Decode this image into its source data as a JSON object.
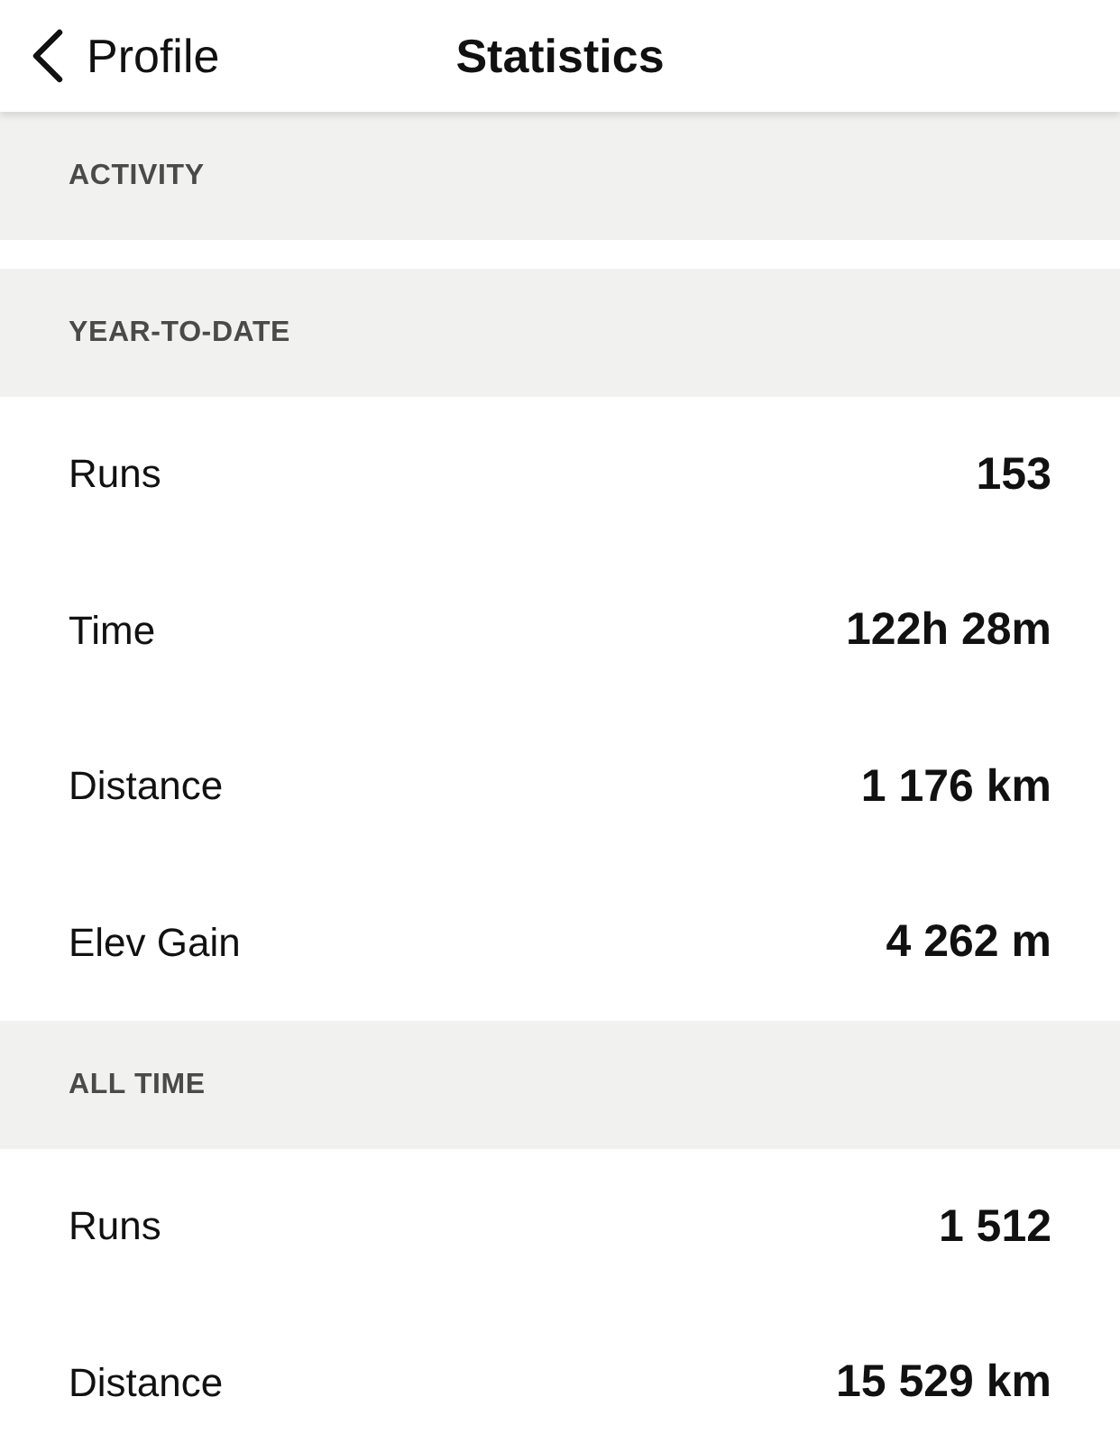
{
  "header": {
    "back_label": "Profile",
    "title": "Statistics"
  },
  "sections": [
    {
      "kind": "group",
      "title": "ACTIVITY"
    },
    {
      "kind": "section",
      "title": "YEAR-TO-DATE",
      "rows": [
        {
          "label": "Runs",
          "value": "153"
        },
        {
          "label": "Time",
          "value": "122h 28m"
        },
        {
          "label": "Distance",
          "value": "1 176 km"
        },
        {
          "label": "Elev Gain",
          "value": "4 262 m"
        }
      ]
    },
    {
      "kind": "section",
      "title": "ALL TIME",
      "rows": [
        {
          "label": "Runs",
          "value": "1 512"
        },
        {
          "label": "Distance",
          "value": "15 529 km"
        }
      ]
    }
  ]
}
